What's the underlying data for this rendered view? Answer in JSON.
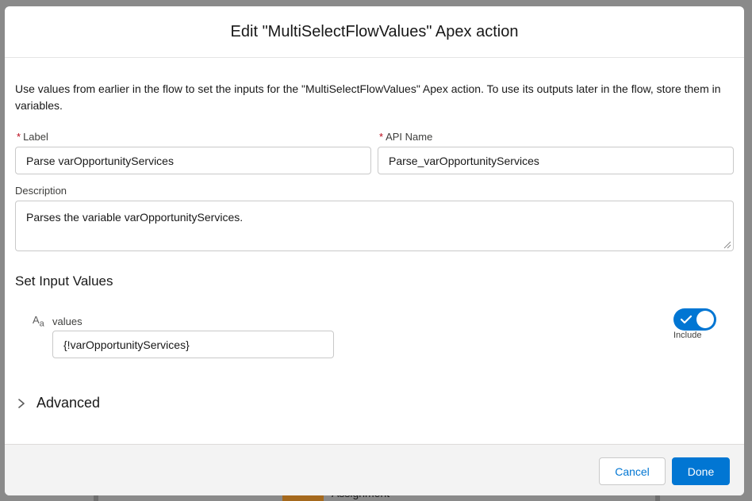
{
  "background": {
    "node_label": "Assignment"
  },
  "modal": {
    "title": "Edit \"MultiSelectFlowValues\" Apex action",
    "intro": "Use values from earlier in the flow to set the inputs for the \"MultiSelectFlowValues\" Apex action. To use its outputs later in the flow, store them in variables.",
    "label_field": {
      "required_marker": "*",
      "label": "Label",
      "value": "Parse varOpportunityServices"
    },
    "api_name_field": {
      "required_marker": "*",
      "label": "API Name",
      "value": "Parse_varOpportunityServices"
    },
    "description_field": {
      "label": "Description",
      "value": "Parses the variable varOpportunityServices."
    },
    "input_section": {
      "title": "Set Input Values",
      "type_icon": "text-type-icon",
      "type_icon_text": {
        "main": "A",
        "sub": "a"
      },
      "param_label": "values",
      "param_value": "{!varOpportunityServices}",
      "include_toggle": {
        "on": true,
        "caption": "Include"
      }
    },
    "advanced": {
      "label": "Advanced",
      "icon": "chevron-right-icon"
    },
    "footer": {
      "cancel_label": "Cancel",
      "done_label": "Done"
    }
  },
  "colors": {
    "brand": "#0176d3",
    "required": "#ba0517",
    "footer_bg": "#f3f3f3"
  }
}
